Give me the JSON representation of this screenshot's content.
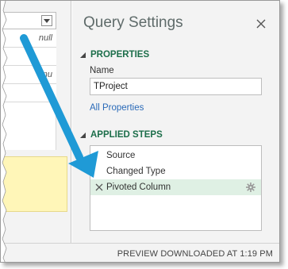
{
  "grid": {
    "cells": [
      "null",
      "",
      "nu",
      ""
    ]
  },
  "pane": {
    "title": "Query Settings",
    "properties": {
      "heading": "PROPERTIES",
      "name_label": "Name",
      "name_value": "TProject",
      "all_properties_link": "All Properties"
    },
    "applied_steps": {
      "heading": "APPLIED STEPS",
      "steps": [
        {
          "label": "Source",
          "selected": false
        },
        {
          "label": "Changed Type",
          "selected": false
        },
        {
          "label": "Pivoted Column",
          "selected": true
        }
      ]
    }
  },
  "status_bar": {
    "text": "PREVIEW DOWNLOADED AT 1:19 PM"
  },
  "colors": {
    "accent_green": "#1c6e4a",
    "arrow_blue": "#1f9ad6",
    "link_blue": "#2a6ab8",
    "selected_row": "#dff0e4",
    "note_yellow": "#fff6b8"
  },
  "icons": {
    "close": "close-icon",
    "collapse": "triangle-down-icon",
    "delete_step": "delete-x-icon",
    "step_settings": "gear-icon",
    "dropdown": "chevron-down-icon"
  }
}
